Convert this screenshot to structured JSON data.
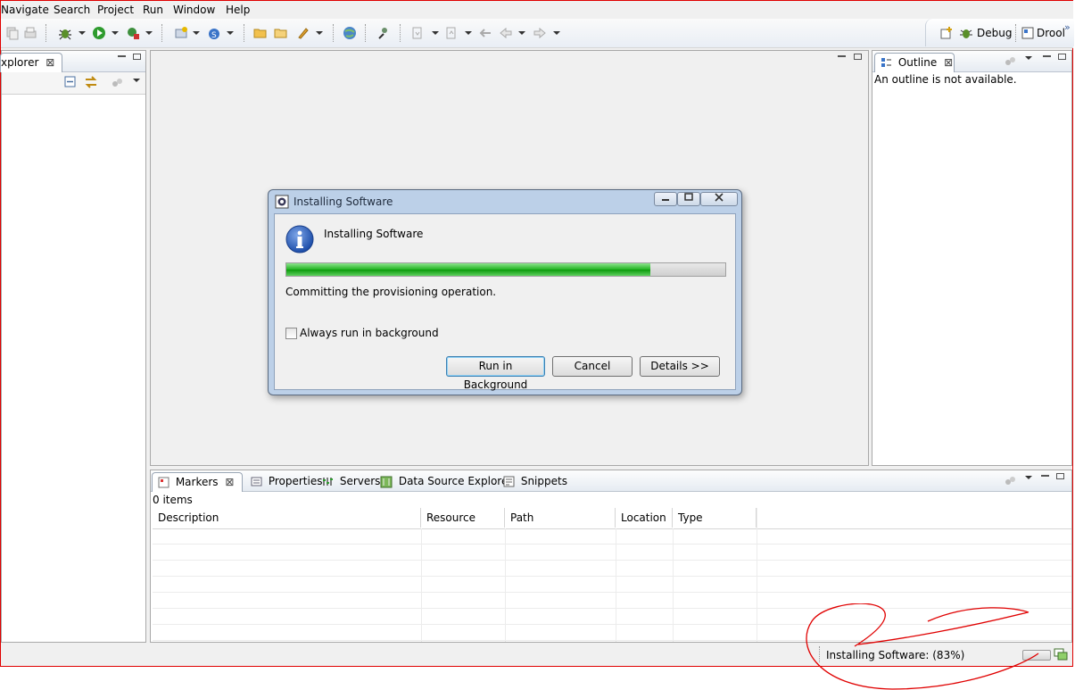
{
  "menu": [
    "Navigate",
    "Search",
    "Project",
    "Run",
    "Window",
    "Help"
  ],
  "perspectives": {
    "debug": "Debug",
    "drools": "Drool",
    "more": "»"
  },
  "explorer": {
    "tab_label": "xplorer",
    "close": "⊠"
  },
  "outline": {
    "tab_label": "Outline",
    "message": "An outline is not available."
  },
  "bottom_tabs": [
    "Markers",
    "Properties",
    "Servers",
    "Data Source Explorer",
    "Snippets"
  ],
  "markers": {
    "count_text": "0 items",
    "columns": [
      "Description",
      "Resource",
      "Path",
      "Location",
      "Type"
    ],
    "sort_indicator": "^"
  },
  "dialog": {
    "title": "Installing Software",
    "heading": "Installing Software",
    "progress_percent": 83,
    "status": "Committing the provisioning operation.",
    "checkbox_label": "Always run in background",
    "checkbox_checked": false,
    "buttons": {
      "run_in_background": "Run in Background",
      "cancel": "Cancel",
      "details": "Details >>"
    }
  },
  "status": {
    "text": "Installing Software: (83%)"
  },
  "colors": {
    "annotation": "#e00000",
    "progress": "#22b422",
    "info_icon": "#2d5fb8"
  }
}
